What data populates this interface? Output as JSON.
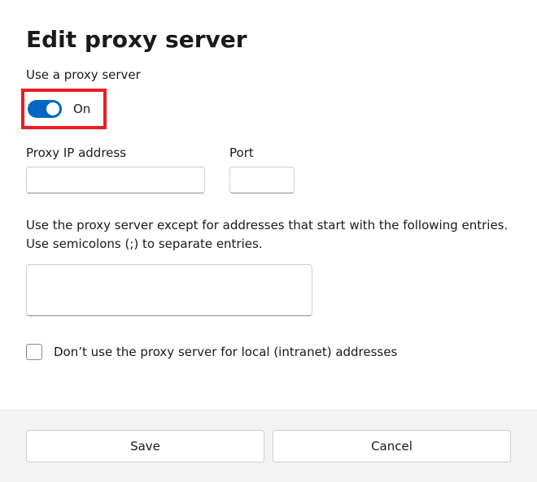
{
  "title": "Edit proxy server",
  "use_proxy_label": "Use a proxy server",
  "toggle": {
    "state": "On",
    "on": true
  },
  "ip_field": {
    "label": "Proxy IP address",
    "value": ""
  },
  "port_field": {
    "label": "Port",
    "value": ""
  },
  "exceptions": {
    "description": "Use the proxy server except for addresses that start with the following entries. Use semicolons (;) to separate entries.",
    "value": ""
  },
  "local_bypass": {
    "label": "Don’t use the proxy server for local (intranet) addresses",
    "checked": false
  },
  "buttons": {
    "save": "Save",
    "cancel": "Cancel"
  },
  "colors": {
    "accent": "#0067c0",
    "highlight": "#ed1c24"
  }
}
